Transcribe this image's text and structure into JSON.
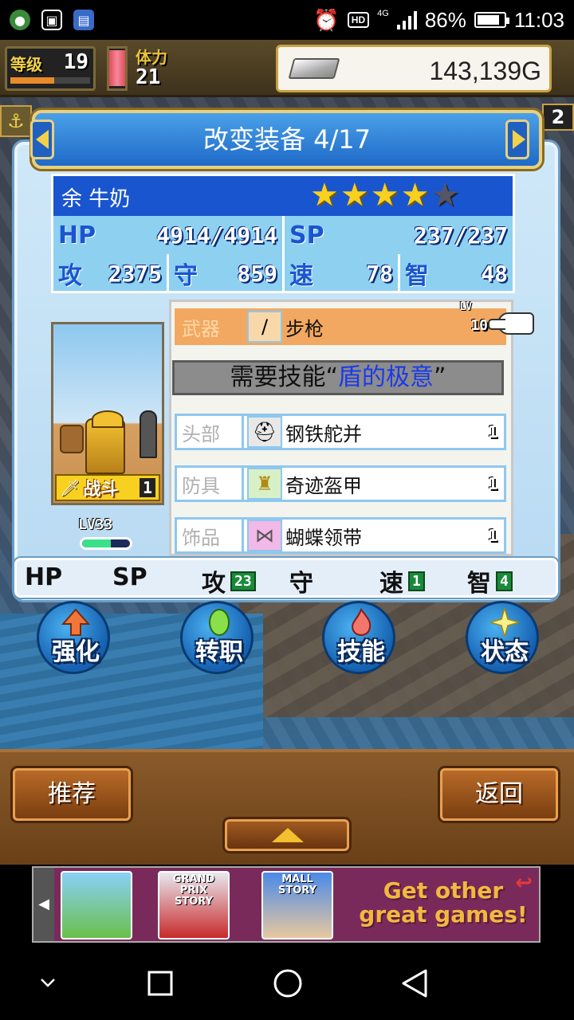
{
  "status_bar": {
    "battery": "86%",
    "time": "11:03",
    "hd": "HD",
    "network": "4G"
  },
  "hud": {
    "level_label": "等级",
    "level": "19",
    "level_progress": 0.55,
    "stamina_label": "体力",
    "stamina": "21",
    "gold": "143,139G",
    "side_right": "2"
  },
  "dialog": {
    "title": "改变装备 4/17"
  },
  "character": {
    "name": "余 牛奶",
    "stars_filled": 4,
    "stars_total": 5,
    "hp_label": "HP",
    "hp": "4914/4914",
    "sp_label": "SP",
    "sp": "237/237",
    "atk_label": "攻",
    "atk": "2375",
    "def_label": "守",
    "def": "859",
    "spd_label": "速",
    "spd": "78",
    "int_label": "智",
    "int": "48",
    "class_label": "战斗",
    "class_level": "1",
    "lv_text": "LV33",
    "lv_progress": 0.6
  },
  "equipment": {
    "weapon": {
      "slot": "武器",
      "name": "步枪",
      "lv_tag": "LV",
      "lv": "10"
    },
    "skill_required_prefix": "需要技能“",
    "skill_required_name": "盾的极意",
    "skill_required_suffix": "”",
    "items": [
      {
        "slot": "头部",
        "name": "钢铁舵并",
        "count": "1"
      },
      {
        "slot": "防具",
        "name": "奇迹盔甲",
        "count": "1"
      },
      {
        "slot": "饰品",
        "name": "蝴蝶领带",
        "count": "1"
      }
    ]
  },
  "bonus": {
    "hp_label": "HP",
    "sp_label": "SP",
    "atk_label": "攻",
    "atk": "23",
    "def_label": "守",
    "spd_label": "速",
    "spd": "1",
    "int_label": "智",
    "int": "4"
  },
  "actions": [
    {
      "label": "强化",
      "icon": "arrow-up-icon"
    },
    {
      "label": "转职",
      "icon": "leaf-icon"
    },
    {
      "label": "技能",
      "icon": "flame-icon"
    },
    {
      "label": "状态",
      "icon": "sparkle-icon"
    }
  ],
  "buttons": {
    "recommend": "推荐",
    "back": "返回"
  },
  "ad": {
    "tile1": "",
    "tile2": "GRAND PRIX STORY",
    "tile3": "MALL STORY",
    "promo": "Get other great games!"
  },
  "colors": {
    "title_blue": "#1e6ac8",
    "skill_blue": "#1a3ae8",
    "weapon_highlight": "#f2a860",
    "star_gold": "#f8d020"
  }
}
